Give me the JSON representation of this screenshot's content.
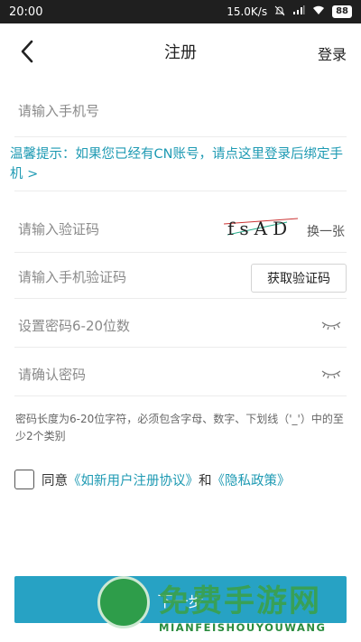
{
  "status": {
    "time": "20:00",
    "speed": "15.0K/s",
    "battery": "88"
  },
  "nav": {
    "title": "注册",
    "login": "登录"
  },
  "form": {
    "phone_placeholder": "请输入手机号",
    "hint": "温馨提示：如果您已经有CN账号，请点这里登录后绑定手机 >",
    "captcha_placeholder": "请输入验证码",
    "captcha_text": "fsAD",
    "captcha_refresh": "换一张",
    "sms_placeholder": "请输入手机验证码",
    "sms_button": "获取验证码",
    "password_placeholder": "设置密码6-20位数",
    "confirm_placeholder": "请确认密码",
    "rule": "密码长度为6-20位字符，必须包含字母、数字、下划线（'_'）中的至少2个类别"
  },
  "agreement": {
    "prefix": "同意",
    "terms": "《如新用户注册协议》",
    "and": "和",
    "privacy": "《隐私政策》"
  },
  "next_button": "下一步",
  "watermark": {
    "title": "免费手游网",
    "subtitle": "MIANFEISHOUYOUWANG"
  },
  "colors": {
    "accent": "#27a2c4",
    "link": "#1e9ab3",
    "watermark": "#3aa04c"
  }
}
